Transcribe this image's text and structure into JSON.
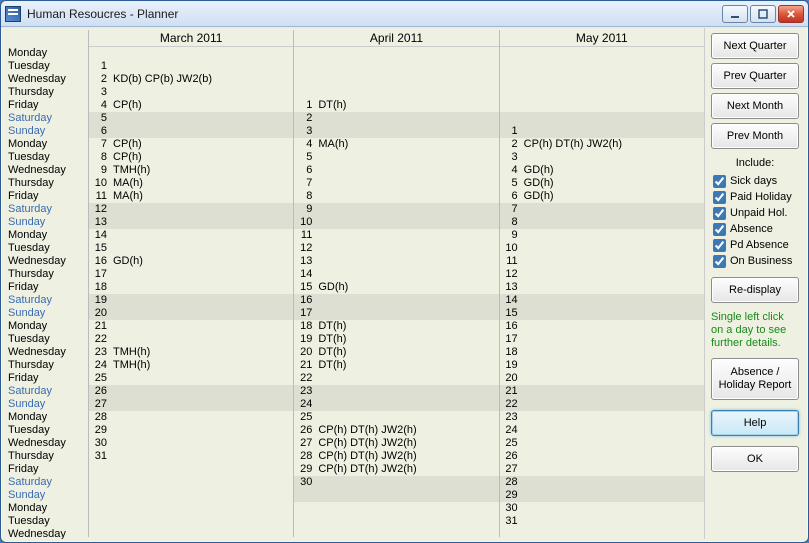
{
  "window": {
    "title": "Human Resoucres  -  Planner"
  },
  "dayNames": [
    "Monday",
    "Tuesday",
    "Wednesday",
    "Thursday",
    "Friday",
    "Saturday",
    "Sunday"
  ],
  "calendar": {
    "rowCount": 38,
    "startDayIndex": 0,
    "months": [
      {
        "label": "March  2011",
        "startRow": 1,
        "days": 31,
        "weekendShadeBlank": false,
        "events": {
          "2": "KD(b) CP(b) JW2(b)",
          "4": "CP(h)",
          "7": "CP(h)",
          "8": "CP(h)",
          "9": "TMH(h)",
          "10": "MA(h)",
          "11": "MA(h)",
          "16": "GD(h)",
          "23": "TMH(h)",
          "24": "TMH(h)"
        }
      },
      {
        "label": "April  2011",
        "startRow": 4,
        "days": 30,
        "weekendShadeBlank": true,
        "events": {
          "1": "DT(h)",
          "4": "MA(h)",
          "15": "GD(h)",
          "18": "DT(h)",
          "19": "DT(h)",
          "20": "DT(h)",
          "21": "DT(h)",
          "26": "CP(h) DT(h) JW2(h)",
          "27": "CP(h) DT(h) JW2(h)",
          "28": "CP(h) DT(h) JW2(h)",
          "29": "CP(h) DT(h) JW2(h)"
        }
      },
      {
        "label": "May  2011",
        "startRow": 6,
        "days": 31,
        "weekendShadeBlank": true,
        "events": {
          "2": "CP(h) DT(h) JW2(h)",
          "4": "GD(h)",
          "5": "GD(h)",
          "6": "GD(h)"
        }
      }
    ]
  },
  "sidebar": {
    "nextQuarter": "Next Quarter",
    "prevQuarter": "Prev Quarter",
    "nextMonth": "Next Month",
    "prevMonth": "Prev Month",
    "includeLabel": "Include:",
    "checks": [
      {
        "label": "Sick days",
        "checked": true
      },
      {
        "label": "Paid Holiday",
        "checked": true
      },
      {
        "label": "Unpaid Hol.",
        "checked": true
      },
      {
        "label": "Absence",
        "checked": true
      },
      {
        "label": "Pd Absence",
        "checked": true
      },
      {
        "label": "On Business",
        "checked": true
      }
    ],
    "redisplay": "Re-display",
    "hint": "Single left click on a day to see further details.",
    "report": "Absence / Holiday Report",
    "help": "Help",
    "ok": "OK"
  }
}
